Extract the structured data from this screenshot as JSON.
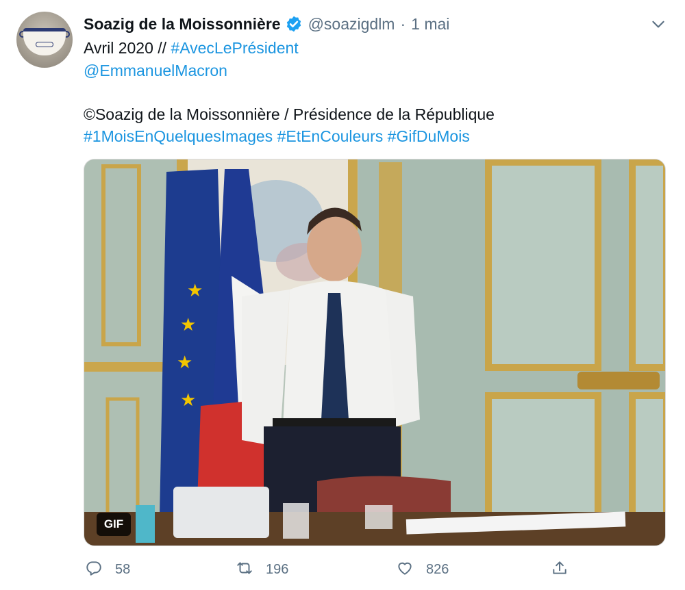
{
  "tweet": {
    "display_name": "Soazig de la Moissonnière",
    "handle": "@soazigdlm",
    "separator": "·",
    "date": "1 mai",
    "verified": true,
    "line1_plain": "Avril 2020 // ",
    "line1_hashtag": "#AvecLePrésident",
    "mention": "@EmmanuelMacron",
    "credit": "©Soazig de la Moissonnière / Présidence de la République",
    "hashtags": [
      "#1MoisEnQuelquesImages",
      "#EtEnCouleurs",
      "#GifDuMois"
    ]
  },
  "media": {
    "badge": "GIF"
  },
  "actions": {
    "replies": "58",
    "retweets": "196",
    "likes": "826"
  },
  "colors": {
    "link": "#1b95e0",
    "secondary_text": "#5b7083",
    "verified": "#1da1f2",
    "flag_eu": "#1d3c8f",
    "flag_fr_blue": "#1f3a93",
    "flag_fr_red": "#d0312d"
  },
  "icons": [
    "verified-badge-icon",
    "chevron-down-icon",
    "reply-icon",
    "retweet-icon",
    "like-icon",
    "share-icon"
  ]
}
